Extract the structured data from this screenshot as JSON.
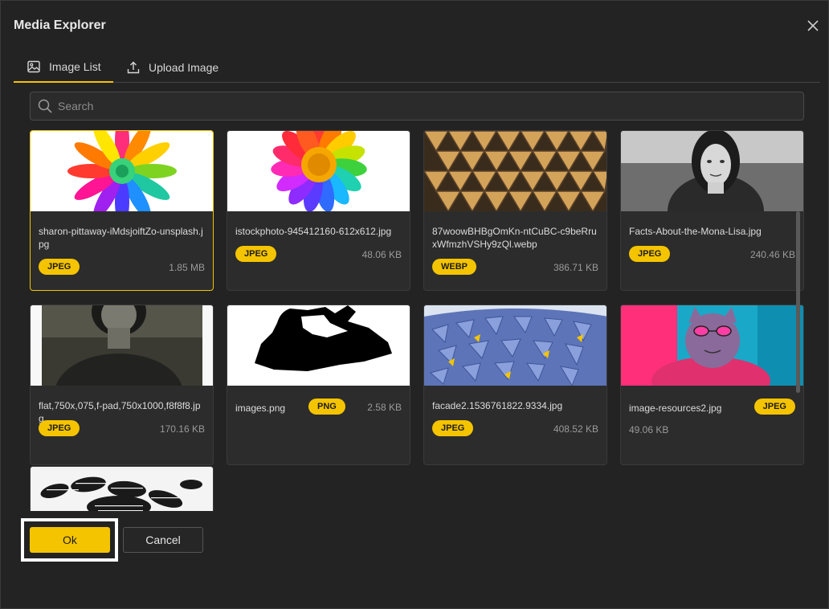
{
  "dialog": {
    "title": "Media Explorer"
  },
  "tabs": [
    {
      "label": "Image List",
      "icon": "image-icon",
      "active": true
    },
    {
      "label": "Upload Image",
      "icon": "upload-icon",
      "active": false
    }
  ],
  "search": {
    "placeholder": "Search",
    "value": ""
  },
  "images": [
    {
      "name": "sharon-pittaway-iMdsjoiftZo-unsplash.jpg",
      "type": "JPEG",
      "size": "1.85 MB",
      "selected": true
    },
    {
      "name": "istockphoto-945412160-612x612.jpg",
      "type": "JPEG",
      "size": "48.06 KB",
      "selected": false
    },
    {
      "name": "87woowBHBgOmKn-ntCuBC-c9beRruxWfmzhVSHy9zQl.webp",
      "type": "WEBP",
      "size": "386.71 KB",
      "selected": false
    },
    {
      "name": "Facts-About-the-Mona-Lisa.jpg",
      "type": "JPEG",
      "size": "240.46 KB",
      "selected": false
    },
    {
      "name": "flat,750x,075,f-pad,750x1000,f8f8f8.jpg",
      "type": "JPEG",
      "size": "170.16 KB",
      "selected": false
    },
    {
      "name": "images.png",
      "type": "PNG",
      "size": "2.58 KB",
      "selected": false
    },
    {
      "name": "facade2.1536761822.9334.jpg",
      "type": "JPEG",
      "size": "408.52 KB",
      "selected": false
    },
    {
      "name": "image-resources2.jpg",
      "type": "JPEG",
      "size": "49.06 KB",
      "selected": false
    },
    {
      "name": "",
      "type": "",
      "size": "",
      "selected": false
    }
  ],
  "footer": {
    "ok_label": "Ok",
    "cancel_label": "Cancel"
  },
  "colors": {
    "accent": "#f5c400",
    "background": "#232323",
    "card": "#2c2c2c"
  }
}
